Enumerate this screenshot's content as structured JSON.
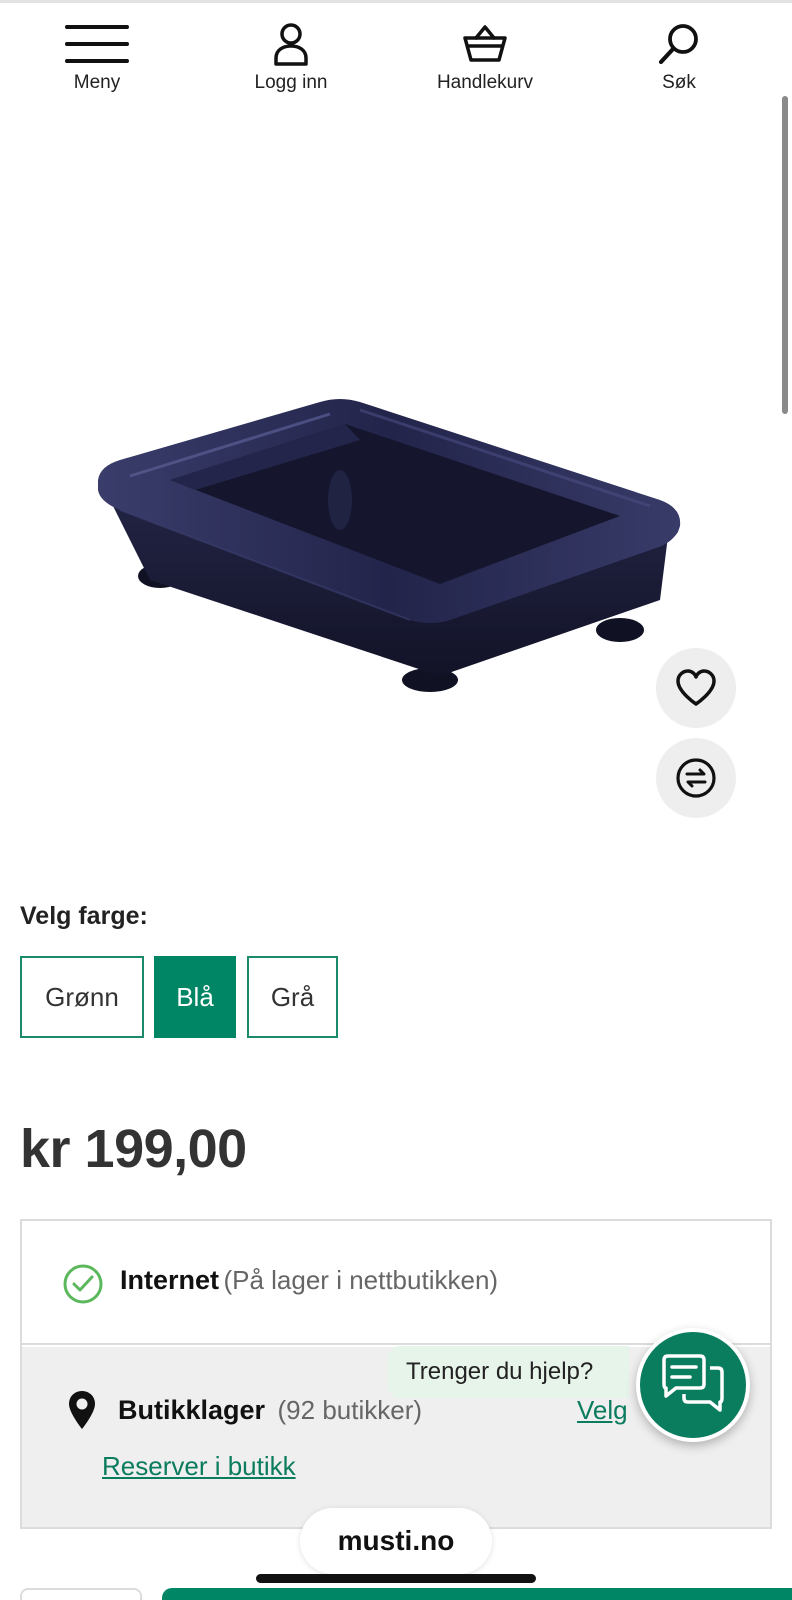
{
  "nav": {
    "menu_label": "Meny",
    "login_label": "Logg inn",
    "cart_label": "Handlekurv",
    "search_label": "Søk"
  },
  "product": {
    "color_label": "Velg farge:",
    "colors": [
      {
        "label": "Grønn",
        "selected": false
      },
      {
        "label": "Blå",
        "selected": true
      },
      {
        "label": "Grå",
        "selected": false
      }
    ],
    "price": "kr 199,00"
  },
  "stock": {
    "internet_title": "Internet",
    "internet_status": "(På lager i nettbutikken)",
    "store_title": "Butikklager",
    "store_count": "(92 butikker)",
    "store_select": "Velg",
    "reserve_link": "Reserver i butikk"
  },
  "help": {
    "bubble_text": "Trenger du hjelp?"
  },
  "browser": {
    "domain": "musti.no"
  },
  "colors": {
    "brand_green": "#008565",
    "check_green": "#5cb85c",
    "product_blue": "#1c1d3a"
  }
}
